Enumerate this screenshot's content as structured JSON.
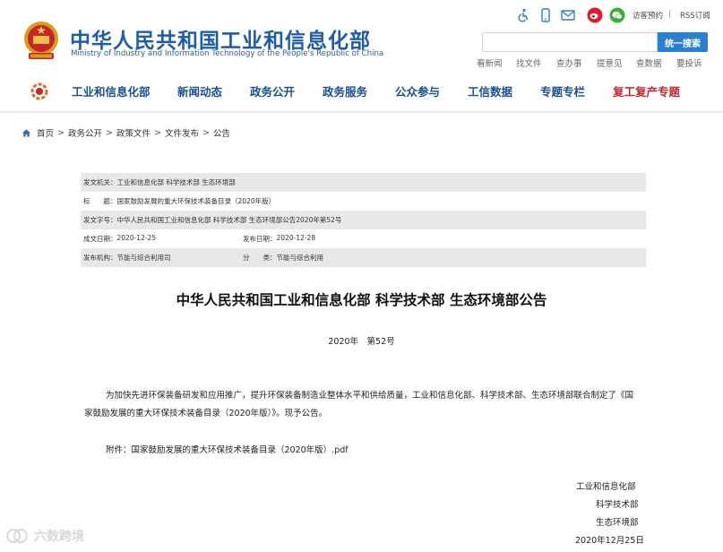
{
  "header": {
    "title": "中华人民共和国工业和信息化部",
    "subtitle": "Ministry of Industry and Information Technology of the People's Republic of China",
    "top_links": [
      "访客预约",
      "RSS订阅"
    ],
    "top_separator": "|",
    "search": {
      "placeholder": "",
      "button": "统一搜索"
    },
    "quick_links": [
      "看新闻",
      "找文件",
      "查办事",
      "提意见",
      "查数据",
      "要投诉"
    ]
  },
  "nav": {
    "items": [
      "工业和信息化部",
      "新闻动态",
      "政务公开",
      "政务服务",
      "公众参与",
      "工信数据",
      "专题专栏",
      "复工复产专题"
    ]
  },
  "breadcrumb": {
    "items": [
      "首页",
      "政务公开",
      "政策文件",
      "文件发布",
      "公告"
    ],
    "separator": ">"
  },
  "meta": {
    "issuer_label": "发文机关：",
    "issuer": "工业和信息化部 科学技术部 生态环境部",
    "title_label": "标　　题：",
    "title": "国家鼓励发展的重大环保技术装备目录（2020年版）",
    "doc_no_label": "发文字号：",
    "doc_no": "中华人民共和国工业和信息化部 科学技术部 生态环境部公告2020年第52号",
    "created_label": "成文日期：",
    "created": "2020-12-25",
    "published_label": "发布日期：",
    "published": "2020-12-28",
    "org_label": "发布机构：",
    "org": "节能与综合利用司",
    "category_label": "分　　类：",
    "category": "节能与综合利用"
  },
  "document": {
    "title": "中华人民共和国工业和信息化部 科学技术部 生态环境部公告",
    "number": "2020年　第52号",
    "paragraph": "为加快先进环保装备研发和应用推广，提升环保装备制造业整体水平和供给质量，工业和信息化部、科学技术部、生态环境部联合制定了《国家鼓励发展的重大环保技术装备目录（2020年版）》。现予公告。",
    "attachment": "附件：国家鼓励发展的重大环保技术装备目录（2020年版）.pdf",
    "signatories": [
      "工业和信息化部",
      "科学技术部",
      "生态环境部"
    ],
    "date": "2020年12月25日"
  },
  "watermark": {
    "text": "六数跨境"
  },
  "colors": {
    "brand_blue": "#1f5da8",
    "nav_blue": "#1b4f93",
    "special_red": "#c0262d",
    "search_button": "#2b7fd3",
    "meta_shade": "#e8e8e8"
  },
  "icons": [
    "national-emblem",
    "accessibility-icon",
    "mobile-icon",
    "mail-icon",
    "weibo-icon",
    "wechat-icon",
    "home-icon",
    "ministry-logo-icon"
  ]
}
